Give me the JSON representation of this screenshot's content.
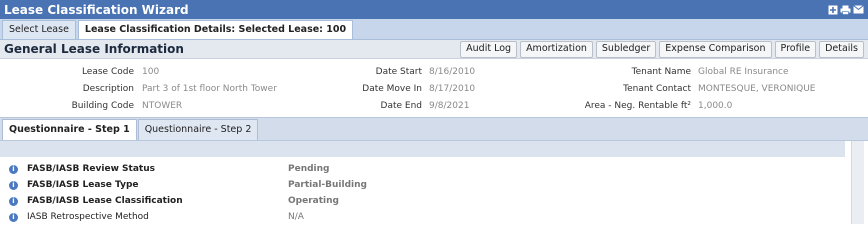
{
  "window": {
    "title": "Lease Classification Wizard",
    "icons": [
      "plus-box-icon",
      "print-icon",
      "email-icon"
    ]
  },
  "tabs": [
    {
      "label": "Select Lease",
      "active": false
    },
    {
      "label": "Lease Classification Details: Selected Lease: 100",
      "active": true
    }
  ],
  "section": {
    "heading": "General Lease Information",
    "actions": [
      "Audit Log",
      "Amortization",
      "Subledger",
      "Expense Comparison",
      "Profile",
      "Details"
    ]
  },
  "lease_info": {
    "lease_code_label": "Lease Code",
    "lease_code": "100",
    "description_label": "Description",
    "description": "Part 3 of 1st floor North Tower",
    "building_code_label": "Building Code",
    "building_code": "NTOWER",
    "date_start_label": "Date Start",
    "date_start": "8/16/2010",
    "date_move_in_label": "Date Move In",
    "date_move_in": "8/17/2010",
    "date_end_label": "Date End",
    "date_end": "9/8/2021",
    "tenant_name_label": "Tenant Name",
    "tenant_name": "Global RE Insurance",
    "tenant_contact_label": "Tenant Contact",
    "tenant_contact": "MONTESQUE, VERONIQUE",
    "area_label": "Area - Neg. Rentable ft²",
    "area": "1,000.0"
  },
  "questionnaire_tabs": [
    {
      "label": "Questionnaire - Step 1",
      "active": true
    },
    {
      "label": "Questionnaire - Step 2",
      "active": false
    }
  ],
  "questions": [
    {
      "label": "FASB/IASB Review Status",
      "value": "Pending",
      "bold": true
    },
    {
      "label": "FASB/IASB Lease Type",
      "value": "Partial-Building",
      "bold": true
    },
    {
      "label": "FASB/IASB Lease Classification",
      "value": "Operating",
      "bold": true
    },
    {
      "label": "IASB Retrospective Method",
      "value": "N/A",
      "bold": false
    }
  ],
  "colors": {
    "title_bar": "#4a73b3",
    "info_icon": "#4b7ac0"
  }
}
